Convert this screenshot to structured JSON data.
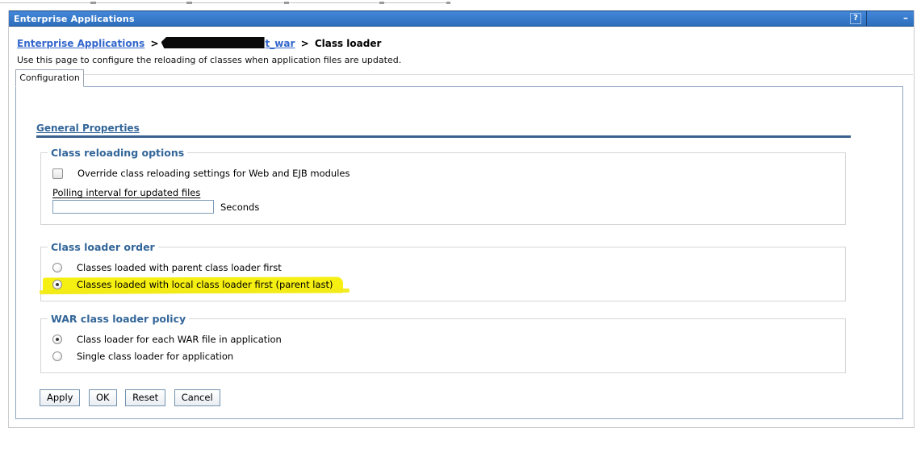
{
  "window": {
    "title": "Enterprise Applications",
    "help_icon": "?",
    "minimize_icon": "–"
  },
  "breadcrumb": {
    "root": "Enterprise Applications",
    "separator": ">",
    "app_suffix": "t_war",
    "current": "Class loader"
  },
  "description": "Use this page to configure the reloading of classes when application files are updated.",
  "tabs": [
    {
      "label": "Configuration"
    }
  ],
  "general_properties_heading": "General Properties",
  "sections": {
    "class_reloading": {
      "legend": "Class reloading options",
      "checkbox_label": "Override class reloading settings for Web and EJB modules",
      "checkbox_checked": false,
      "polling_label": "Polling interval for updated files",
      "polling_value": "",
      "polling_unit": "Seconds"
    },
    "class_loader_order": {
      "legend": "Class loader order",
      "options": [
        {
          "label": "Classes loaded with parent class loader first",
          "selected": false,
          "highlighted": false
        },
        {
          "label": "Classes loaded with local class loader first (parent last)",
          "selected": true,
          "highlighted": true
        }
      ]
    },
    "war_policy": {
      "legend": "WAR class loader policy",
      "options": [
        {
          "label": "Class loader for each WAR file in application",
          "selected": true
        },
        {
          "label": "Single class loader for application",
          "selected": false
        }
      ]
    }
  },
  "buttons": [
    {
      "label": "Apply"
    },
    {
      "label": "OK"
    },
    {
      "label": "Reset"
    },
    {
      "label": "Cancel"
    }
  ],
  "colors": {
    "titlebar_blue": "#3578c8",
    "link_blue": "#3366cc",
    "heading_blue": "#336699",
    "highlight_yellow": "#f6ef12",
    "panel_border": "#8fa6c0"
  }
}
